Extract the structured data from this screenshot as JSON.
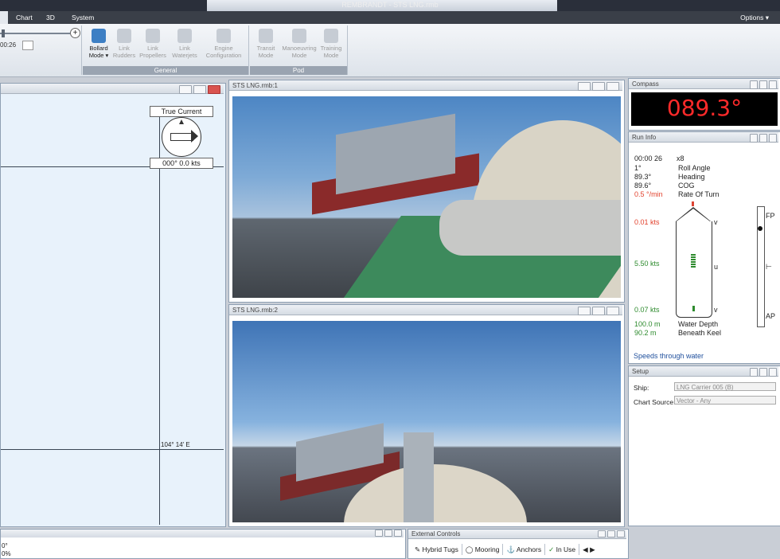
{
  "window": {
    "title": "REMBRANDT - STS LNG.rmb"
  },
  "menu": {
    "items": [
      "Chart",
      "3D",
      "System"
    ],
    "options": "Options ▾"
  },
  "toolbar": {
    "time_value": "00:26"
  },
  "ribbon": {
    "general": {
      "label": "General",
      "buttons": [
        {
          "label": "Bollard Mode ▾",
          "active": true
        },
        {
          "label": "Link Rudders",
          "active": false
        },
        {
          "label": "Link Propellers",
          "active": false
        },
        {
          "label": "Link Waterjets",
          "active": false
        },
        {
          "label": "Engine Configuration",
          "active": false
        }
      ]
    },
    "pod": {
      "label": "Pod",
      "buttons": [
        {
          "label": "Transit Mode",
          "active": false
        },
        {
          "label": "Manoeuvring Mode",
          "active": false
        },
        {
          "label": "Training Mode",
          "active": false
        }
      ]
    }
  },
  "chart": {
    "true_current_label": "True Current",
    "current_value": "000° 0.0 kts",
    "coord_label": "104° 14' E"
  },
  "views": [
    {
      "title": "STS LNG.rmb:1"
    },
    {
      "title": "STS LNG.rmb:2"
    }
  ],
  "compass": {
    "title": "Compass",
    "value": "089.3°"
  },
  "run_info": {
    "title": "Run Info",
    "time": "00:00 26",
    "speed_mult": "x8",
    "rows": [
      {
        "value": "1°",
        "label": "Roll Angle"
      },
      {
        "value": "89.3°",
        "label": "Heading"
      },
      {
        "value": "89.6°",
        "label": "COG"
      },
      {
        "value": "0.5 °/min",
        "label": "Rate Of Turn"
      }
    ],
    "speeds": {
      "front": "0.01 kts",
      "mid": "5.50 kts",
      "aft": "0.07 kts"
    },
    "markers": {
      "v": "v",
      "u": "u"
    },
    "scale_labels": {
      "fp": "FP",
      "ap": "AP"
    },
    "depth": [
      {
        "value": "100.0 m",
        "label": "Water Depth"
      },
      {
        "value": "90.2 m",
        "label": "Beneath Keel"
      }
    ],
    "footer": "Speeds through water"
  },
  "setup": {
    "title": "Setup",
    "ship_label": "Ship:",
    "ship_value": "LNG Carrier 005 (B)",
    "source_label": "Chart Source:",
    "source_value": "Vector - Any"
  },
  "bottom": {
    "left_values": [
      "0°",
      "0%"
    ],
    "external_title": "External Controls",
    "tabs": [
      "Hybrid Tugs",
      "Mooring",
      "Anchors",
      "In Use"
    ]
  },
  "colors": {
    "compass_bg": "#000000",
    "compass_fg": "#ff2a2a",
    "active_icon": "#3d7fc4"
  }
}
